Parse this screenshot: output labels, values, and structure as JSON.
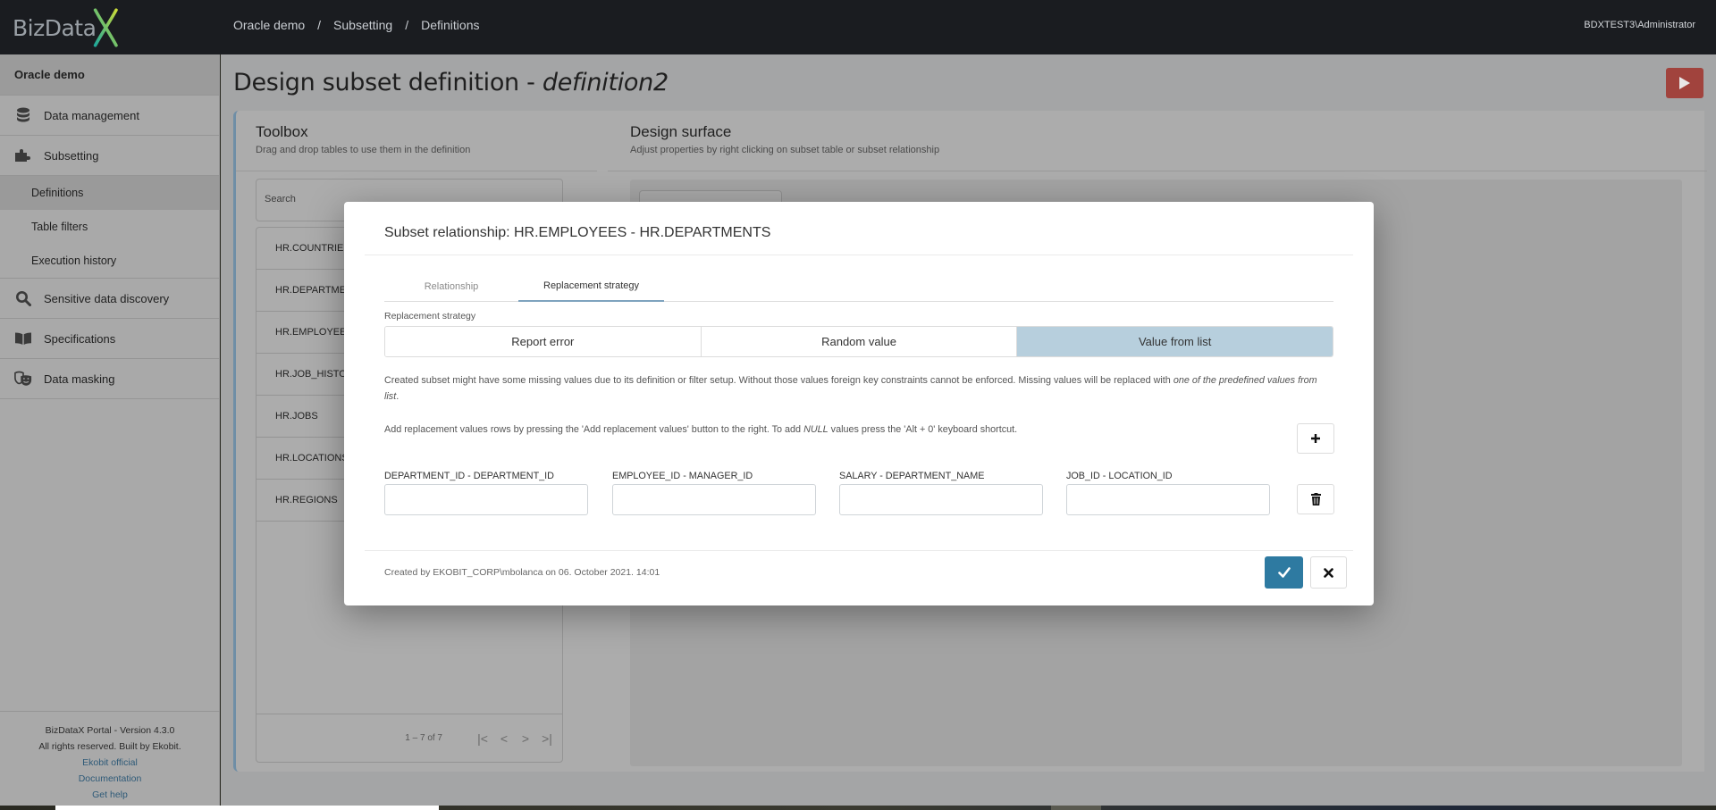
{
  "app": {
    "logo_text": "BizData",
    "logo_mark": "X",
    "brand_gradient": [
      "#2bb3a3",
      "#c5d93a"
    ]
  },
  "navbar": {
    "breadcrumb": [
      "Oracle demo",
      "Subsetting",
      "Definitions"
    ],
    "separator": "/",
    "user": "BDXTEST3\\Administrator"
  },
  "sidebar": {
    "header": "Oracle demo",
    "items": [
      {
        "label": "Data management",
        "icon": "database-icon"
      },
      {
        "label": "Subsetting",
        "icon": "puzzle-icon"
      },
      {
        "label": "Sensitive data discovery",
        "icon": "search-icon"
      },
      {
        "label": "Specifications",
        "icon": "book-icon"
      },
      {
        "label": "Data masking",
        "icon": "masks-icon"
      }
    ],
    "subitems": [
      {
        "label": "Definitions",
        "active": true
      },
      {
        "label": "Table filters",
        "active": false
      },
      {
        "label": "Execution history",
        "active": false
      }
    ],
    "footer": {
      "version": "BizDataX Portal - Version 4.3.0",
      "rights": "All rights reserved. Built by Ekobit.",
      "links": [
        "Ekobit official",
        "Documentation",
        "Get help"
      ]
    }
  },
  "page": {
    "title_prefix": "Design subset definition - ",
    "title_name": "definition2",
    "run_button_icon": "play-icon",
    "run_color": "#a1433d"
  },
  "toolbox": {
    "title": "Toolbox",
    "subtitle": "Drag and drop tables to use them in the definition",
    "search_placeholder": "Search",
    "tables": [
      "HR.COUNTRIES",
      "HR.DEPARTMENTS",
      "HR.EMPLOYEES",
      "HR.JOB_HISTORY",
      "HR.JOBS",
      "HR.LOCATIONS",
      "HR.REGIONS"
    ],
    "pager": {
      "range": "1 – 7 of 7",
      "first": "|<",
      "prev": "<",
      "next": ">",
      "last": ">|"
    }
  },
  "design_surface": {
    "title": "Design surface",
    "subtitle": "Adjust properties by right clicking on subset table or subset relationship"
  },
  "modal": {
    "title": "Subset relationship: HR.EMPLOYEES - HR.DEPARTMENTS",
    "tabs": [
      {
        "label": "Relationship",
        "active": false
      },
      {
        "label": "Replacement strategy",
        "active": true
      }
    ],
    "strategy_label": "Replacement strategy",
    "strategies": [
      {
        "label": "Report error",
        "selected": false
      },
      {
        "label": "Random value",
        "selected": false
      },
      {
        "label": "Value from list",
        "selected": true
      }
    ],
    "description_plain": "Created subset might have some missing values due to its definition or filter setup. Without those values foreign key constraints cannot be enforced. Missing values will be replaced with ",
    "description_em": "one of the predefined values from list",
    "description_end": ".",
    "hint_before": "Add replacement values rows by pressing the 'Add replacement values' button to the right. To add ",
    "hint_em": "NULL",
    "hint_after": " values press the 'Alt + 0' keyboard shortcut.",
    "fields": [
      {
        "label": "DEPARTMENT_ID - DEPARTMENT_ID",
        "value": ""
      },
      {
        "label": "EMPLOYEE_ID - MANAGER_ID",
        "value": ""
      },
      {
        "label": "SALARY - DEPARTMENT_NAME",
        "value": ""
      },
      {
        "label": "JOB_ID - LOCATION_ID",
        "value": ""
      }
    ],
    "add_icon": "plus-icon",
    "delete_icon": "trash-icon",
    "created": "Created by EKOBIT_CORP\\mbolanca on 06. October 2021. 14:01",
    "ok_icon": "check-icon",
    "cancel_icon": "close-icon",
    "accent": "#2e7aa1",
    "selected_color": "#b7cfdd"
  }
}
